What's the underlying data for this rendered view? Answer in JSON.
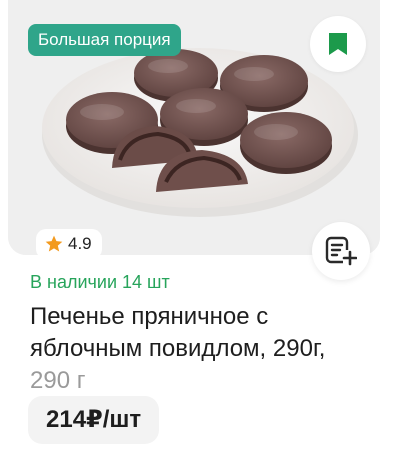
{
  "product": {
    "badge": "Большая порция",
    "rating": "4.9",
    "stock": "В наличии 14 шт",
    "title": "Печенье пряничное с яблочным повидлом, 290г,",
    "weight": "290 г",
    "price": "214₽/шт"
  },
  "icons": {
    "bookmark": "bookmark-icon",
    "star": "star-icon",
    "add_to_list": "list-add-icon"
  },
  "colors": {
    "badge_bg": "#2fa58a",
    "bookmark": "#1c9a4b",
    "stock_text": "#27a45b",
    "star": "#f39a1e",
    "weight_text": "#9a9a9a"
  }
}
